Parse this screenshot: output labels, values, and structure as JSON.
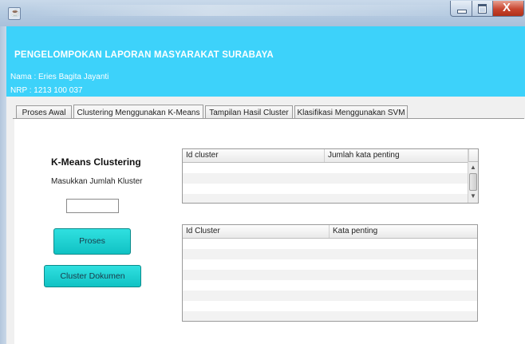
{
  "header": {
    "title": "PENGELOMPOKAN LAPORAN MASYARAKAT SURABAYA",
    "name_line": "Nama : Eries Bagita Jayanti",
    "nrp_line": "NRP : 1213 100 037"
  },
  "tabs": [
    {
      "label": "Proses Awal",
      "active": false
    },
    {
      "label": "Clustering Menggunakan K-Means",
      "active": true
    },
    {
      "label": "Tampilan Hasil Cluster",
      "active": false
    },
    {
      "label": "Klasifikasi Menggunakan SVM",
      "active": false
    }
  ],
  "kmeans": {
    "title": "K-Means Clustering",
    "input_label": "Masukkan Jumlah Kluster",
    "input_value": "",
    "proses_button": "Proses",
    "cluster_button": "Cluster Dokumen"
  },
  "table_top": {
    "columns": [
      "Id cluster",
      "Jumlah kata penting"
    ],
    "rows": []
  },
  "table_bottom": {
    "columns": [
      "Id Cluster",
      "Kata penting"
    ],
    "rows": []
  },
  "colors": {
    "header_bg": "#3dd2fa",
    "button_bg": "#1fd0d2"
  },
  "icons": {
    "app": "java-cup-icon",
    "minimize": "minimize-icon",
    "maximize": "maximize-icon",
    "close": "close-icon"
  }
}
